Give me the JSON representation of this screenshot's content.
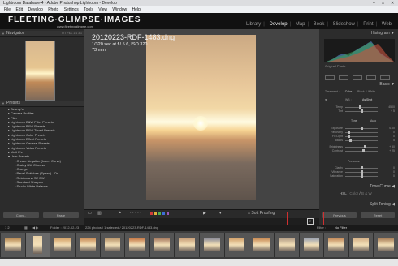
{
  "window": {
    "title": "Lightroom Database-4 - Adobe Photoshop Lightroom - Develop",
    "controls": [
      "–",
      "□",
      "✕"
    ]
  },
  "menu": [
    "File",
    "Edit",
    "Develop",
    "Photo",
    "Settings",
    "Tools",
    "View",
    "Window",
    "Help"
  ],
  "identity": {
    "logo": "FLEETING·GLIMPSE·IMAGES",
    "url": "www.fleetingglimpse.com"
  },
  "modules": [
    "Library",
    "Develop",
    "Map",
    "Book",
    "Slideshow",
    "Print",
    "Web"
  ],
  "left_panel": {
    "navigator": {
      "title": "Navigator",
      "zoom": "FIT  FILL  1:1  3:1"
    },
    "presets_title": "Presets",
    "presets": [
      "Beardy's",
      "Camera Profiles",
      "Film",
      "Lightroom B&W Filter Presets",
      "Lightroom B&W Presets",
      "Lightroom B&W Toned Presets",
      "Lightroom Color Presets",
      "Lightroom Effect Presets",
      "Lightroom General Presets",
      "Lightroom Video Presets",
      "Matt K's",
      "User Presets",
      "Create Negative (Invert Curve)",
      "Grainy BW Cinema",
      "Grunge",
      "Panel Switches (Speed) - On",
      "Reichmann SE BW",
      "Standard Sharpen",
      "Studio White Balance"
    ],
    "copy_label": "Copy...",
    "paste_label": "Paste"
  },
  "photo_info": {
    "filename": "20120223-RDF-1483.dng",
    "exposure": "1/320 sec at f / 5.6, ISO 320",
    "focal": "73 mm"
  },
  "right_panel": {
    "histogram_title": "Histogram",
    "histogram_info": "Original Photo",
    "basic_title": "Basic",
    "treatment": [
      "Treatment :",
      "Color",
      "Black & White"
    ],
    "wb_label": "WB :",
    "wb_value": "As Shot",
    "tone_label": "Tone",
    "auto_label": "Auto",
    "presence_label": "Presence",
    "sliders": [
      {
        "label": "Temp",
        "value": "4500",
        "pos": 0.45
      },
      {
        "label": "Tint",
        "value": "+ 5",
        "pos": 0.5
      },
      {
        "label": "Exposure",
        "value": "0.00",
        "pos": 0.5
      },
      {
        "label": "Recovery",
        "value": "0",
        "pos": 0.1
      },
      {
        "label": "Fill Light",
        "value": "0",
        "pos": 0.1
      },
      {
        "label": "Blacks",
        "value": "5",
        "pos": 0.15
      },
      {
        "label": "Brightness",
        "value": "+ 50",
        "pos": 0.6
      },
      {
        "label": "Contrast",
        "value": "+ 25",
        "pos": 0.55
      },
      {
        "label": "Clarity",
        "value": "0",
        "pos": 0.5
      },
      {
        "label": "Vibrance",
        "value": "0",
        "pos": 0.5
      },
      {
        "label": "Saturation",
        "value": "0",
        "pos": 0.5
      }
    ],
    "tone_curve_title": "Tone Curve",
    "hsl_tabs": [
      "HSL",
      "/",
      "Color",
      "/",
      "B & W"
    ],
    "split_toning_title": "Split Toning",
    "previous_label": "Previous",
    "reset_label": "Reset"
  },
  "toolbar": {
    "soft_proofing": "Soft Proofing",
    "flag_colors": [
      "#d23b3b",
      "#e0b23a",
      "#4caf50",
      "#3d6fd8",
      "#9b59b6"
    ]
  },
  "filmstrip_bar": {
    "pages": "1  2",
    "path": "Folder : 2012-02-23",
    "count": "224 photos / 1 selected / 20120223-RDF-1483.dng",
    "filter_label": "Filter :",
    "filter_value": "No Filter"
  },
  "filmstrip": {
    "thumb_colors": [
      "#b78a55",
      "#e8d0a6",
      "#d4a36a",
      "#c98f5a",
      "#b9966d",
      "#c67a48",
      "#a97d62",
      "#c8a07a",
      "#8f8f99",
      "#d3a36d",
      "#c98c55",
      "#b6a088",
      "#9fa5b0",
      "#c48c5c",
      "#d7b38a",
      "#a9805a"
    ]
  },
  "status": {}
}
